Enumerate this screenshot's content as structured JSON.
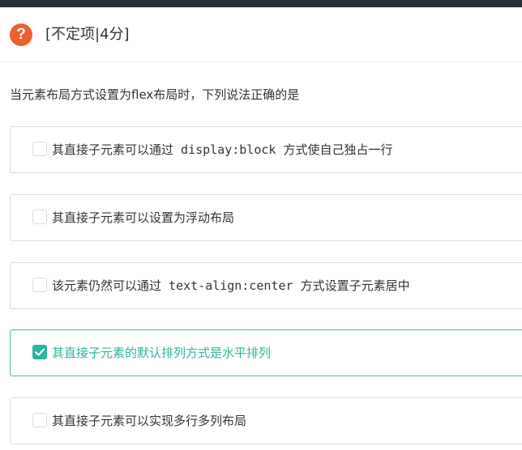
{
  "question": {
    "type_label": "[不定项|4分]",
    "stem": "当元素布局方式设置为flex布局时，下列说法正确的是",
    "icon": "question-icon",
    "icon_glyph": "?"
  },
  "options": [
    {
      "text": "其直接子元素可以通过 display:block 方式使自己独占一行",
      "checked": false
    },
    {
      "text": "其直接子元素可以设置为浮动布局",
      "checked": false
    },
    {
      "text": "该元素仍然可以通过 text-align:center 方式设置子元素居中",
      "checked": false
    },
    {
      "text": "其直接子元素的默认排列方式是水平排列",
      "checked": true
    },
    {
      "text": "其直接子元素可以实现多行多列布局",
      "checked": false
    }
  ],
  "colors": {
    "question_icon": "#f05d2f",
    "checked_accent": "#29b59c",
    "checked_text": "#2fb39b",
    "topbar": "#2b3034"
  }
}
